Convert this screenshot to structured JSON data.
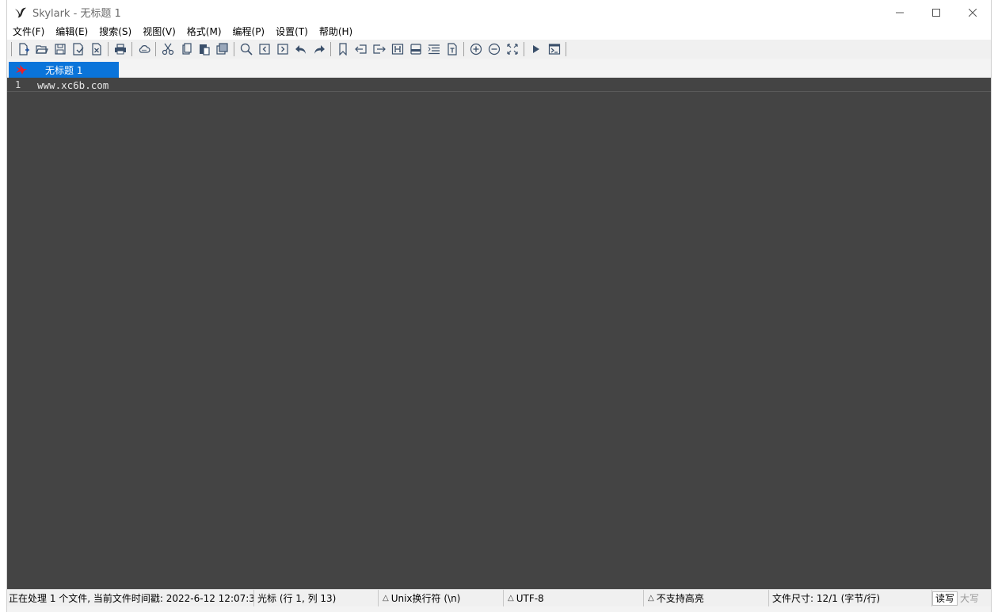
{
  "window": {
    "title": "Skylark - 无标题 1",
    "icon": "skylark-bird-icon",
    "controls": [
      "minimize-icon",
      "maximize-icon",
      "close-icon"
    ]
  },
  "menu": [
    {
      "label": "文件(F)"
    },
    {
      "label": "编辑(E)"
    },
    {
      "label": "搜索(S)"
    },
    {
      "label": "视图(V)"
    },
    {
      "label": "格式(M)"
    },
    {
      "label": "编程(P)"
    },
    {
      "label": "设置(T)"
    },
    {
      "label": "帮助(H)"
    }
  ],
  "toolbar": {
    "groups": [
      [
        "new-file-icon",
        "open-file-icon",
        "save-icon",
        "save-as-icon",
        "close-file-icon"
      ],
      [
        "print-icon"
      ],
      [
        "cloud-icon"
      ],
      [
        "cut-icon",
        "copy-icon",
        "paste-icon",
        "clipboard-icon"
      ],
      [
        "search-icon",
        "find-prev-icon",
        "find-next-icon",
        "undo-icon",
        "redo-icon"
      ],
      [
        "bookmark-icon",
        "indent-left-icon",
        "indent-right-icon",
        "hex-icon",
        "printer-alt-icon",
        "list-icon",
        "file-text-icon"
      ],
      [
        "zoom-in-icon",
        "zoom-out-icon",
        "fullscreen-icon"
      ],
      [
        "run-icon",
        "terminal-icon"
      ]
    ]
  },
  "tabs": [
    {
      "label": "无标题 1",
      "icon": "bird-tab-icon",
      "active": true
    }
  ],
  "editor": {
    "lines": [
      {
        "number": "1",
        "text": "www.xc6b.com"
      }
    ]
  },
  "status": {
    "processing": "正在处理 1 个文件, 当前文件时间戳: 2022-6-12 12:07:34",
    "cursor": "光标 (行 1, 列 13)",
    "eol": "Unix换行符 (\\n)",
    "encoding": "UTF-8",
    "highlight": "不支持高亮",
    "filesize": "文件尺寸: 12/1 (字节/行)",
    "mode_readwrite": "读写",
    "mode_caps": "大写"
  },
  "colors": {
    "editor_bg": "#444444",
    "tab_active": "#0a74da",
    "tab_icon": "#e8202a"
  }
}
